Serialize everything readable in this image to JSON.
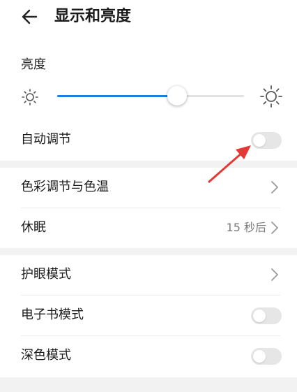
{
  "header": {
    "title": "显示和亮度",
    "back_icon": "arrow-left-icon"
  },
  "brightness": {
    "label": "亮度",
    "level": 0.64,
    "min_icon": "sun-small-icon",
    "max_icon": "sun-large-icon",
    "accent_color": "#1f7ddb"
  },
  "auto_adjust": {
    "label": "自动调节",
    "enabled": false
  },
  "color": {
    "label": "色彩调节与色温"
  },
  "sleep": {
    "label": "休眠",
    "value": "15 秒后"
  },
  "eye_comfort": {
    "label": "护眼模式"
  },
  "ebook": {
    "label": "电子书模式",
    "enabled": false
  },
  "dark_mode": {
    "label": "深色模式",
    "enabled": false
  },
  "annotation": {
    "arrow_color": "#e53935"
  }
}
